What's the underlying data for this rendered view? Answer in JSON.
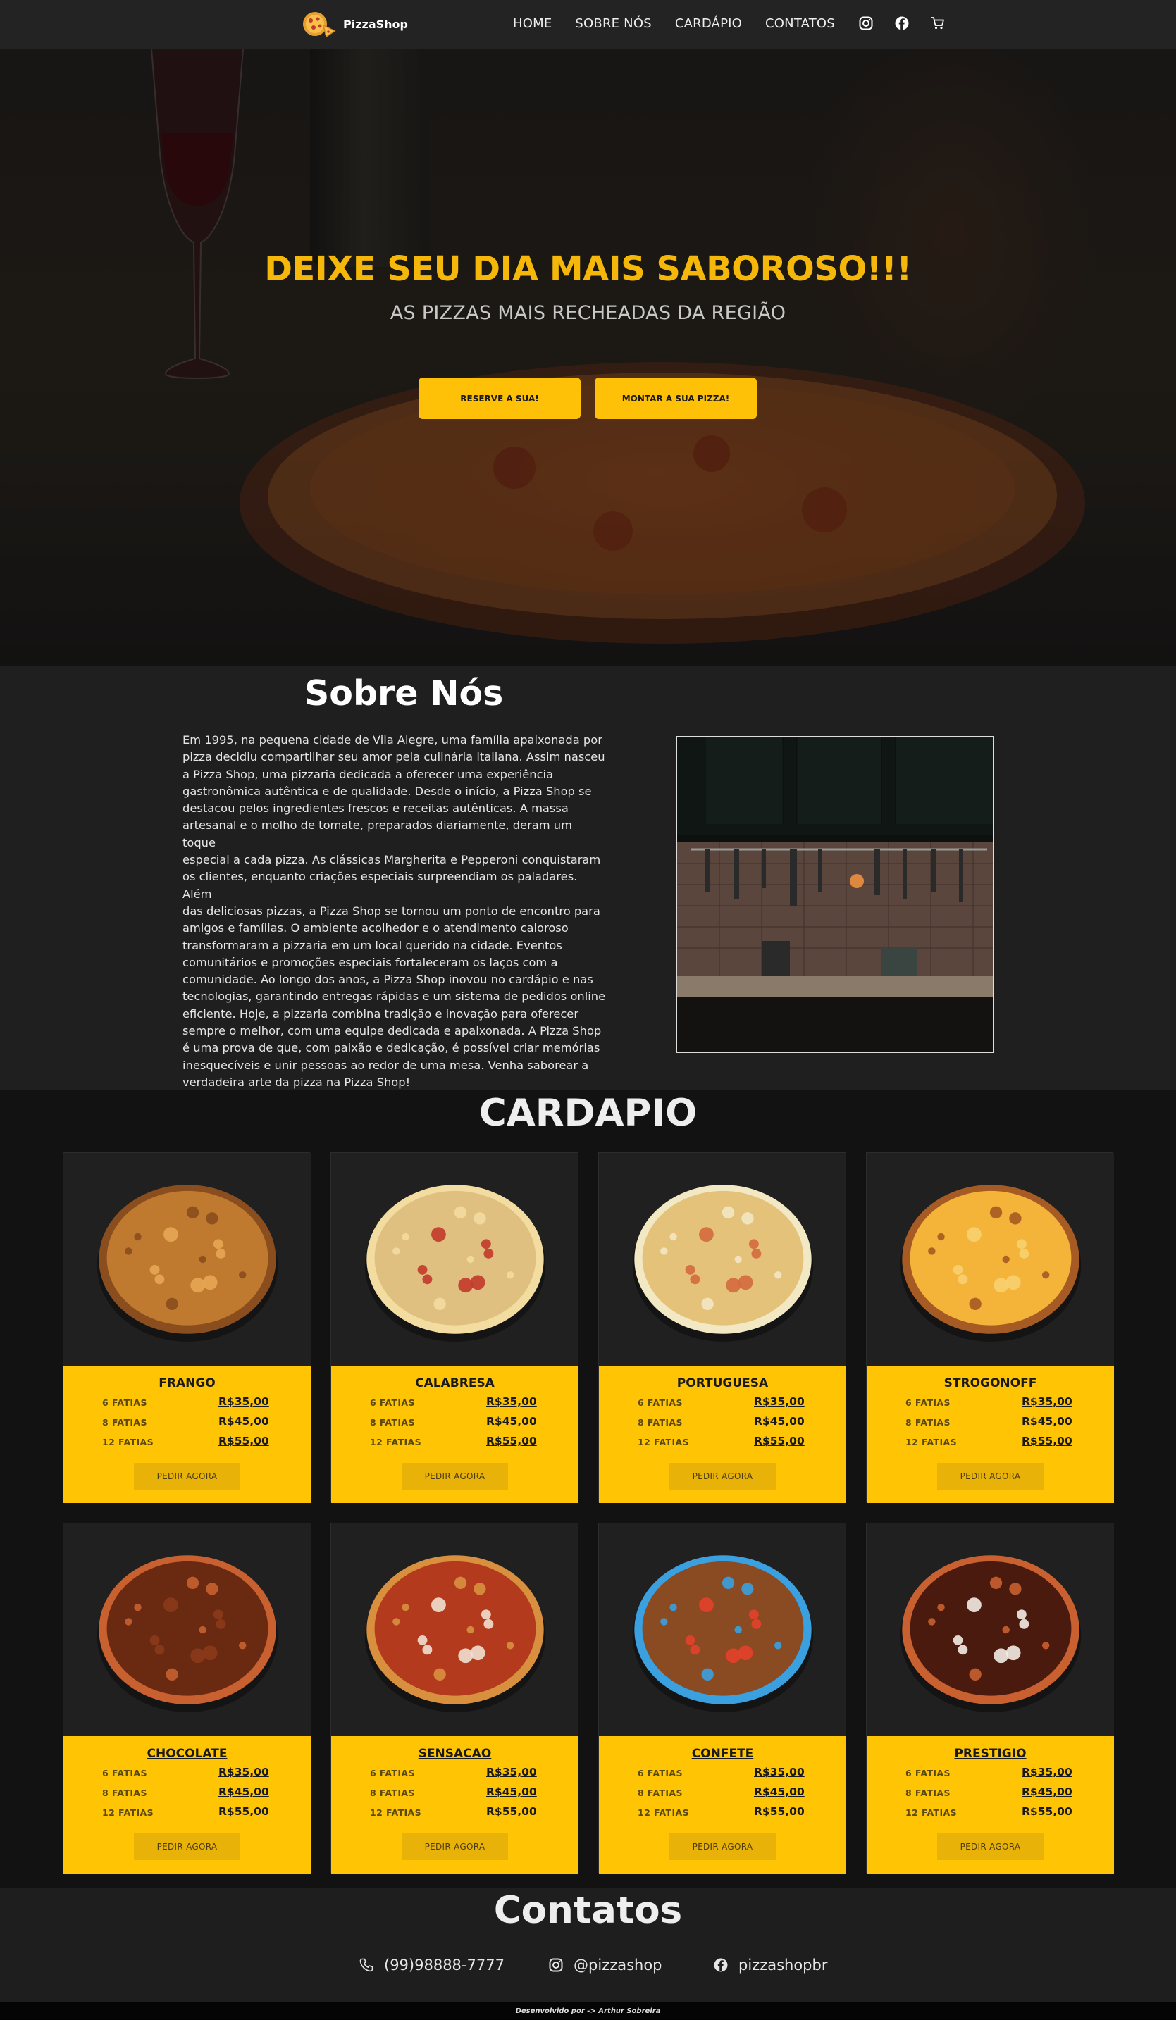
{
  "brand": {
    "name": "PizzaShop"
  },
  "nav": {
    "links": [
      "HOME",
      "SOBRE NÓS",
      "CARDÁPIO",
      "CONTATOS"
    ],
    "icons": [
      "instagram-icon",
      "facebook-icon",
      "cart-icon"
    ]
  },
  "hero": {
    "title": "DEIXE SEU DIA MAIS SABOROSO!!!",
    "subtitle": "AS PIZZAS MAIS RECHEADAS DA REGIÃO",
    "buttons": [
      "RESERVE A SUA!",
      "MONTAR A SUA PIZZA!"
    ]
  },
  "about": {
    "title": "Sobre Nós",
    "lines": [
      "Em 1995, na pequena cidade de Vila Alegre, uma família apaixonada por",
      "pizza decidiu compartilhar seu amor pela culinária italiana. Assim nasceu",
      "a Pizza Shop, uma pizzaria dedicada a oferecer uma experiência",
      "gastronômica autêntica e de qualidade. Desde o início, a Pizza Shop se",
      "destacou pelos ingredientes frescos e receitas autênticas. A massa",
      "artesanal e o molho de tomate, preparados diariamente, deram um toque",
      "especial a cada pizza. As clássicas Margherita e Pepperoni conquistaram",
      "os clientes, enquanto criações especiais surpreendiam os paladares. Além",
      "das deliciosas pizzas, a Pizza Shop se tornou um ponto de encontro para",
      "amigos e famílias. O ambiente acolhedor e o atendimento caloroso",
      "transformaram a pizzaria em um local querido na cidade. Eventos",
      "comunitários e promoções especiais fortaleceram os laços com a",
      "comunidade. Ao longo dos anos, a Pizza Shop inovou no cardápio e nas",
      "tecnologias, garantindo entregas rápidas e um sistema de pedidos online",
      "eficiente. Hoje, a pizzaria combina tradição e inovação para oferecer",
      "sempre o melhor, com uma equipe dedicada e apaixonada. A Pizza Shop",
      "é uma prova de que, com paixão e dedicação, é possível criar memórias",
      "inesquecíveis e unir pessoas ao redor de uma mesa. Venha saborear a",
      "verdadeira arte da pizza na Pizza Shop!"
    ]
  },
  "menu": {
    "title": "CARDAPIO",
    "button_label": "PEDIR AGORA",
    "sizes": [
      "6 FATIAS",
      "8 FATIAS",
      "12 FATIAS"
    ],
    "prices": [
      "R$35,00",
      "R$45,00",
      "R$55,00"
    ],
    "items": [
      {
        "name": "FRANGO",
        "colors": [
          "#c07a30",
          "#e6a654",
          "#8a4e1e"
        ]
      },
      {
        "name": "CALABRESA",
        "colors": [
          "#e0c080",
          "#c23a2a",
          "#f3dca0"
        ]
      },
      {
        "name": "PORTUGUESA",
        "colors": [
          "#e4c27a",
          "#d36a3e",
          "#f2e8c4"
        ]
      },
      {
        "name": "STROGONOFF",
        "colors": [
          "#f4b43a",
          "#f8d070",
          "#a65a24"
        ]
      },
      {
        "name": "CHOCOLATE",
        "colors": [
          "#6a2a12",
          "#8a3a1a",
          "#c86030"
        ]
      },
      {
        "name": "SENSACAO",
        "colors": [
          "#b43a1e",
          "#f0e0d0",
          "#d8903e"
        ]
      },
      {
        "name": "CONFETE",
        "colors": [
          "#8a4a22",
          "#e4402a",
          "#3aa0e0"
        ]
      },
      {
        "name": "PRESTIGIO",
        "colors": [
          "#4a1a0e",
          "#f2ece4",
          "#c86030"
        ]
      }
    ]
  },
  "contacts": {
    "title": "Contatos",
    "phone": "(99)98888-7777",
    "instagram": "@pizzashop",
    "facebook": "pizzashopbr"
  },
  "footer": {
    "text": "Desenvolvido por -> Arthur Sobreira"
  }
}
